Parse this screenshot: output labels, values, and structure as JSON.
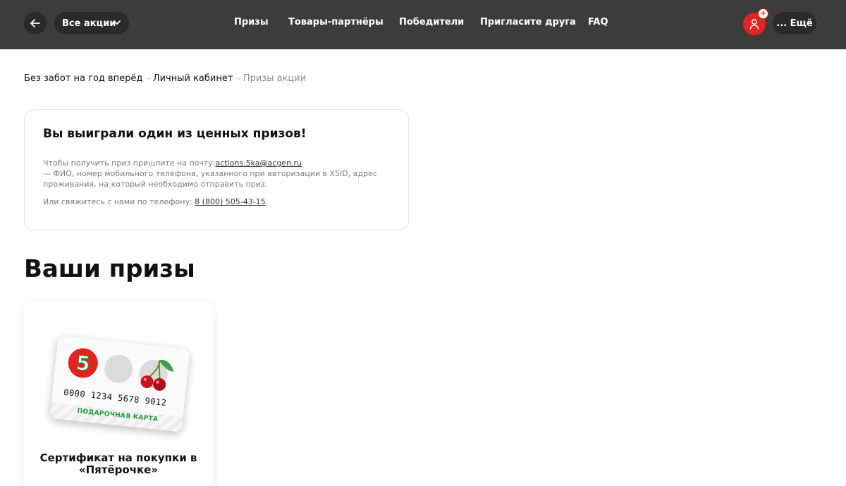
{
  "header": {
    "actions_label": "Все акции",
    "nav": [
      "Призы",
      "Товары-партнёры",
      "Победители",
      "Пригласите друга",
      "FAQ"
    ],
    "badge": "+",
    "more_label": "... Ещё"
  },
  "breadcrumb": {
    "items": [
      "Без забот на год вперёд",
      "Личный кабинет"
    ],
    "current": "Призы акции",
    "separator": "→"
  },
  "info": {
    "title": "Вы выиграли один из ценных призов!",
    "text_before_email": "Чтобы получить приз пришлите на почту:",
    "email": "actions.5ka@acgen.ru",
    "text_after_email": "— ФИО, номер мобильного телефона, указанного при авторизации в X5ID, адрес проживания, на который необходимо отправить приз.",
    "phone_prefix": "Или свяжитесь с нами по телефону: ",
    "phone": "8 (800) 505-43-15",
    "phone_suffix": "."
  },
  "prizes": {
    "title": "Ваши призы",
    "items": [
      {
        "card_number": "0000 1234 5678 9012",
        "card_label": "ПОДАРОЧНАЯ КАРТА",
        "logo_digit": "5",
        "title": "Сертификат на покупки в «Пятёрочке»"
      }
    ]
  },
  "colors": {
    "header_bg": "#3c3c3c",
    "accent_red": "#e3231f",
    "card_green": "#1f9a3a"
  }
}
